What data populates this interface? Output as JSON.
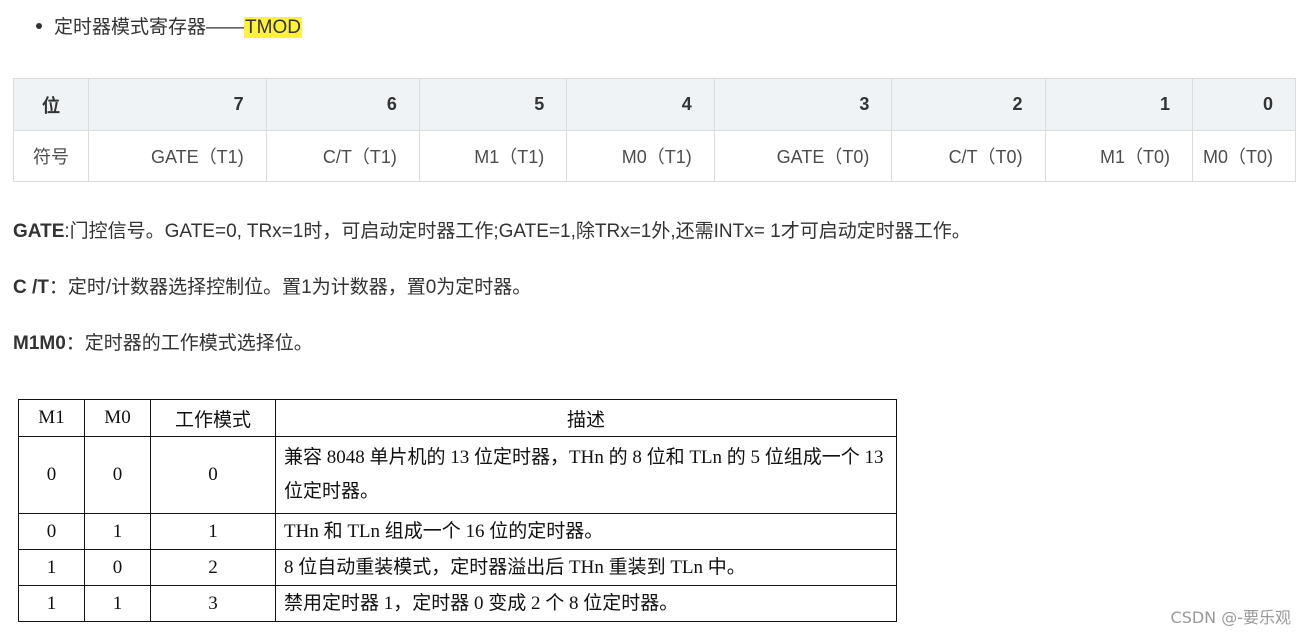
{
  "bullet": {
    "text": "定时器模式寄存器——",
    "highlight": "TMOD"
  },
  "reg_table": {
    "header": [
      "位",
      "7",
      "6",
      "5",
      "4",
      "3",
      "2",
      "1",
      "0"
    ],
    "row": [
      "符号",
      "GATE（T1)",
      "C/T（T1)",
      "M1（T1)",
      "M0（T1)",
      "GATE（T0)",
      "C/T（T0)",
      "M1（T0)",
      "M0（T0)"
    ]
  },
  "paragraphs": [
    {
      "label": "GATE",
      "text": ":门控信号。GATE=0, TRx=1时，可启动定时器工作;GATE=1,除TRx=1外,还需INTx= 1才可启动定时器工作。"
    },
    {
      "label": "C /T",
      "text": "：定时/计数器选择控制位。置1为计数器，置0为定时器。"
    },
    {
      "label": "M1M0",
      "text": "：定时器的工作模式选择位。"
    }
  ],
  "mode_table": {
    "header": [
      "M1",
      "M0",
      "工作模式",
      "描述"
    ],
    "rows": [
      [
        "0",
        "0",
        "0",
        "兼容 8048 单片机的 13 位定时器，THn 的 8 位和 TLn 的 5 位组成一个 13 位定时器。"
      ],
      [
        "0",
        "1",
        "1",
        "THn 和 TLn 组成一个 16 位的定时器。"
      ],
      [
        "1",
        "0",
        "2",
        "8 位自动重装模式，定时器溢出后 THn 重装到 TLn 中。"
      ],
      [
        "1",
        "1",
        "3",
        "禁用定时器 1，定时器 0 变成 2 个 8 位定时器。"
      ]
    ]
  },
  "watermark": "CSDN @-要乐观"
}
